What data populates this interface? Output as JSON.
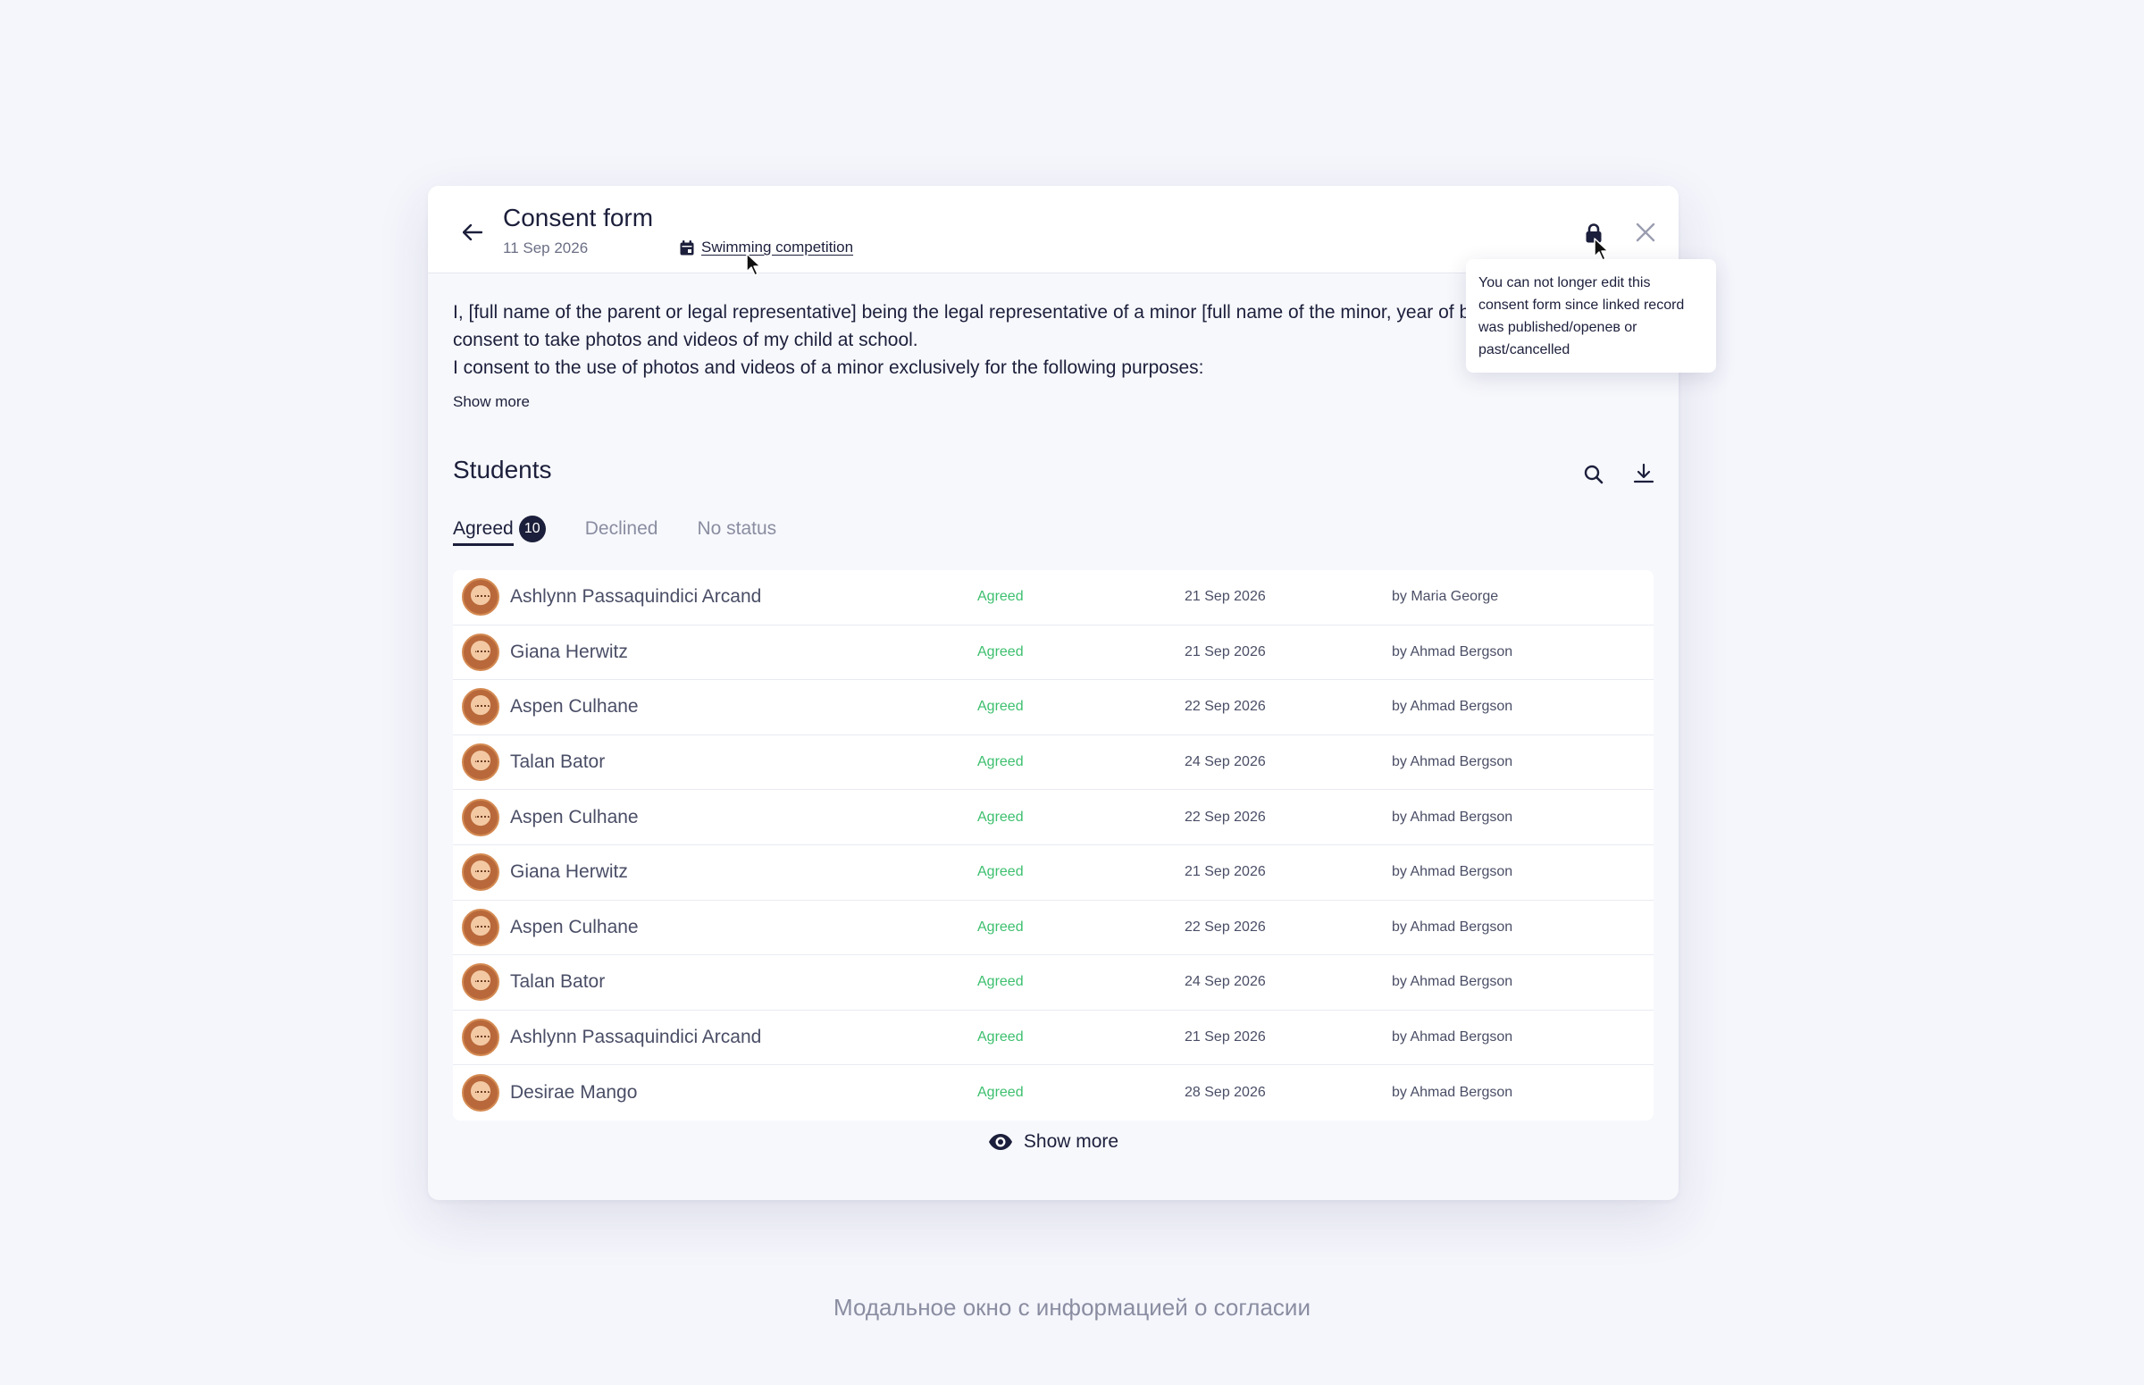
{
  "header": {
    "title": "Consent form",
    "date": "11 Sep 2026",
    "linked_record": "Swimming competition"
  },
  "tooltip": {
    "text": "You can not longer edit this consent form since linked record was published/openeв or past/cancelled"
  },
  "consent_text": {
    "lines": [
      "I, [full name of the parent or legal representative] being the legal representative of a minor [full name of the minor, year of birth], hereby give my",
      "consent to take photos and videos of my child at school.",
      "I consent to the use of photos and videos of a minor exclusively for the following purposes:"
    ],
    "show_more": "Show more"
  },
  "students": {
    "title": "Students",
    "tabs": [
      {
        "label": "Agreed",
        "count": "10",
        "active": true
      },
      {
        "label": "Declined",
        "active": false
      },
      {
        "label": "No status",
        "active": false
      }
    ],
    "rows": [
      {
        "name": "Ashlynn Passaquindici Arcand",
        "status": "Agreed",
        "date": "21 Sep 2026",
        "by": "by Maria George"
      },
      {
        "name": "Giana Herwitz",
        "status": "Agreed",
        "date": "21 Sep 2026",
        "by": "by Ahmad Bergson"
      },
      {
        "name": "Aspen Culhane",
        "status": "Agreed",
        "date": "22 Sep 2026",
        "by": "by Ahmad Bergson"
      },
      {
        "name": "Talan Bator",
        "status": "Agreed",
        "date": "24 Sep 2026",
        "by": "by Ahmad Bergson"
      },
      {
        "name": "Aspen Culhane",
        "status": "Agreed",
        "date": "22 Sep 2026",
        "by": "by Ahmad Bergson"
      },
      {
        "name": "Giana Herwitz",
        "status": "Agreed",
        "date": "21 Sep 2026",
        "by": "by Ahmad Bergson"
      },
      {
        "name": "Aspen Culhane",
        "status": "Agreed",
        "date": "22 Sep 2026",
        "by": "by Ahmad Bergson"
      },
      {
        "name": "Talan Bator",
        "status": "Agreed",
        "date": "24 Sep 2026",
        "by": "by Ahmad Bergson"
      },
      {
        "name": "Ashlynn Passaquindici Arcand",
        "status": "Agreed",
        "date": "21 Sep 2026",
        "by": "by Ahmad Bergson"
      },
      {
        "name": "Desirae Mango",
        "status": "Agreed",
        "date": "28 Sep 2026",
        "by": "by Ahmad Bergson"
      }
    ],
    "show_more": "Show more"
  },
  "caption": "Модальное окно с информацией о согласии",
  "icons": {
    "back": "arrow-left-icon",
    "calendar": "calendar-icon",
    "lock": "lock-icon",
    "close": "close-icon",
    "search": "search-icon",
    "download": "download-icon",
    "eye": "eye-icon"
  },
  "colors": {
    "primary": "#1c1f3b",
    "agreed": "#3cbf6e",
    "muted": "#8a8da1",
    "background": "#f5f6fc"
  }
}
